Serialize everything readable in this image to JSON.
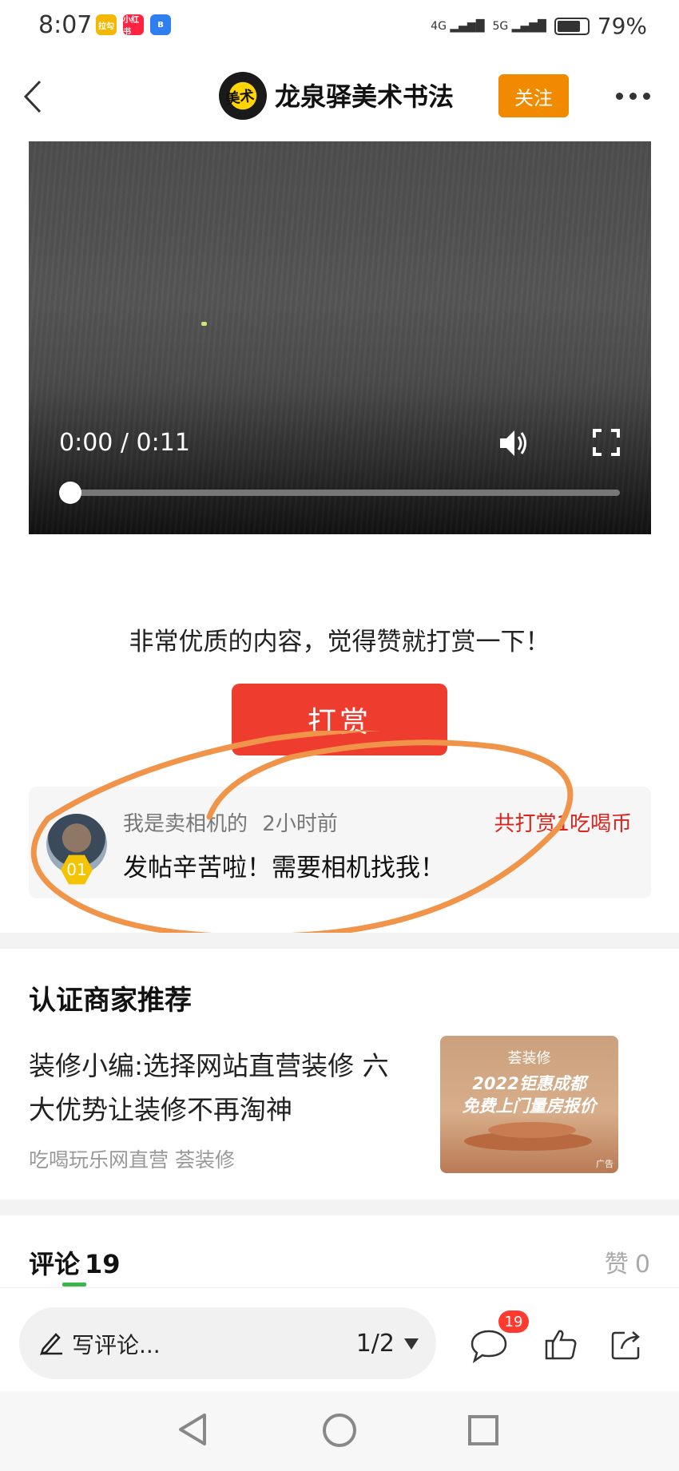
{
  "status_bar": {
    "time": "8:07",
    "app_icons": [
      {
        "label": "拉勾",
        "color": "#f5b800"
      },
      {
        "label": "小红书",
        "color": "#ff2442"
      },
      {
        "label": "B",
        "color": "#2f7ff0"
      }
    ],
    "signal_1": "4G",
    "signal_2": "5G",
    "battery": "79%",
    "battery_level": 0.79
  },
  "header": {
    "logo_text": "美术",
    "account_name": "龙泉驿美术书法",
    "follow_label": "关注"
  },
  "video": {
    "time": "0:00 / 0:11",
    "progress": 0
  },
  "reward": {
    "prompt": "非常优质的内容，觉得赞就打赏一下！",
    "button_label": "打赏"
  },
  "reward_record": {
    "rank": "01",
    "user": "我是卖相机的",
    "time_ago": "2小时前",
    "total": "共打赏1吃喝币",
    "message": "发帖辛苦啦！需要相机找我！"
  },
  "merchant": {
    "section_title": "认证商家推荐",
    "title": "装修小编:选择网站直营装修 六大优势让装修不再淘神",
    "source_site": "吃喝玩乐网直营",
    "source_brand": "荟装修",
    "ad_brand": "荟装修",
    "ad_line1": "2022钜惠成都",
    "ad_line2": "免费上门量房报价",
    "ad_tag": "广告"
  },
  "comments": {
    "title": "评论",
    "count": "19",
    "likes_label": "赞",
    "likes_count": "0"
  },
  "bottom_bar": {
    "placeholder": "写评论...",
    "page_indicator": "1/2",
    "comment_badge": "19"
  },
  "colors": {
    "accent_orange": "#f28a00",
    "reward_red": "#ee3c2e",
    "annotation": "#f0944a"
  }
}
